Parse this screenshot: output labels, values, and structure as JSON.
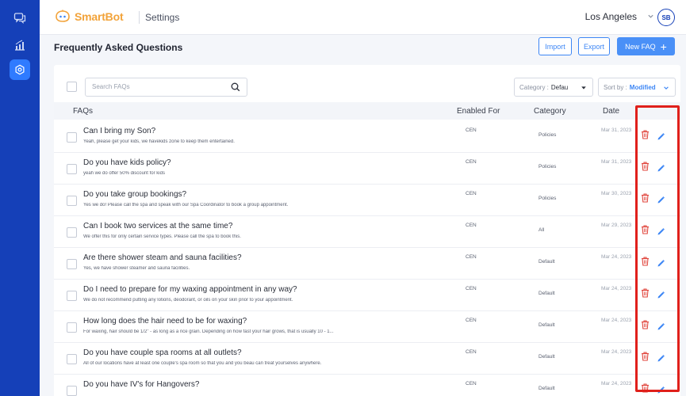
{
  "app": {
    "brand": "SmartBot",
    "section": "Settings",
    "location": "Los Angeles",
    "user_initials": "SB"
  },
  "sidebar": {
    "items": [
      "chat-icon",
      "analytics-icon",
      "settings-icon"
    ],
    "active": "settings-icon"
  },
  "page": {
    "title": "Frequently Asked Questions"
  },
  "toolbar": {
    "import_label": "Import",
    "export_label": "Export",
    "new_label": "New FAQ"
  },
  "filters": {
    "search_placeholder": "Search FAQs",
    "category_prefix": "Category :",
    "category_value": "Defau",
    "sort_prefix": "Sort by :",
    "sort_value": "Modified"
  },
  "table": {
    "columns": {
      "faqs": "FAQs",
      "enabled_for": "Enabled For",
      "category": "Category",
      "date": "Date"
    },
    "rows": [
      {
        "q": "Can I bring my Son?",
        "a": "Yeah, please get your kids, we havekids zone to keep them entertained.",
        "enabled": "CEN",
        "category": "Policies",
        "date": "Mar 31, 2023"
      },
      {
        "q": "Do you have kids policy?",
        "a": "yeah we do offer 50% discount for kids",
        "enabled": "CEN",
        "category": "Policies",
        "date": "Mar 31, 2023"
      },
      {
        "q": "Do you take group bookings?",
        "a": "Yes we do! Please call the spa and speak with our Spa Coordinator to book a group appointment.",
        "enabled": "CEN",
        "category": "Policies",
        "date": "Mar 30, 2023"
      },
      {
        "q": "Can I book two services at the same time?",
        "a": "We offer this for only certain service types. Please call the spa to book this.",
        "enabled": "CEN",
        "category": "All",
        "date": "Mar 29, 2023"
      },
      {
        "q": "Are there shower steam and sauna facilities?",
        "a": "Yes, we have shower steamer and sauna facilities.",
        "enabled": "CEN",
        "category": "Default",
        "date": "Mar 24, 2023"
      },
      {
        "q": "Do I need to prepare for my waxing appointment in any way?",
        "a": "We do not recommend putting any lotions, deodorant, or oils on your skin prior to your appointment.",
        "enabled": "CEN",
        "category": "Default",
        "date": "Mar 24, 2023"
      },
      {
        "q": "How long does the hair need to be for waxing?",
        "a": "For waxing, hair should be 1/2\" - as long as a rice grain. Depending on how fast your hair grows, that is usually 10 - 1...",
        "enabled": "CEN",
        "category": "Default",
        "date": "Mar 24, 2023"
      },
      {
        "q": "Do you have couple spa rooms at all outlets?",
        "a": "All of our locations have at least one couple's spa room so that you and you beau can treat yourselves anywhere.",
        "enabled": "CEN",
        "category": "Default",
        "date": "Mar 24, 2023"
      },
      {
        "q": "Do you have IV's for Hangovers?",
        "a": "",
        "enabled": "CEN",
        "category": "Default",
        "date": "Mar 24, 2023"
      }
    ]
  },
  "colors": {
    "rail": "#1540b8",
    "accent": "#3d86f5",
    "delete": "#e0443b",
    "highlight": "#e0201b"
  }
}
